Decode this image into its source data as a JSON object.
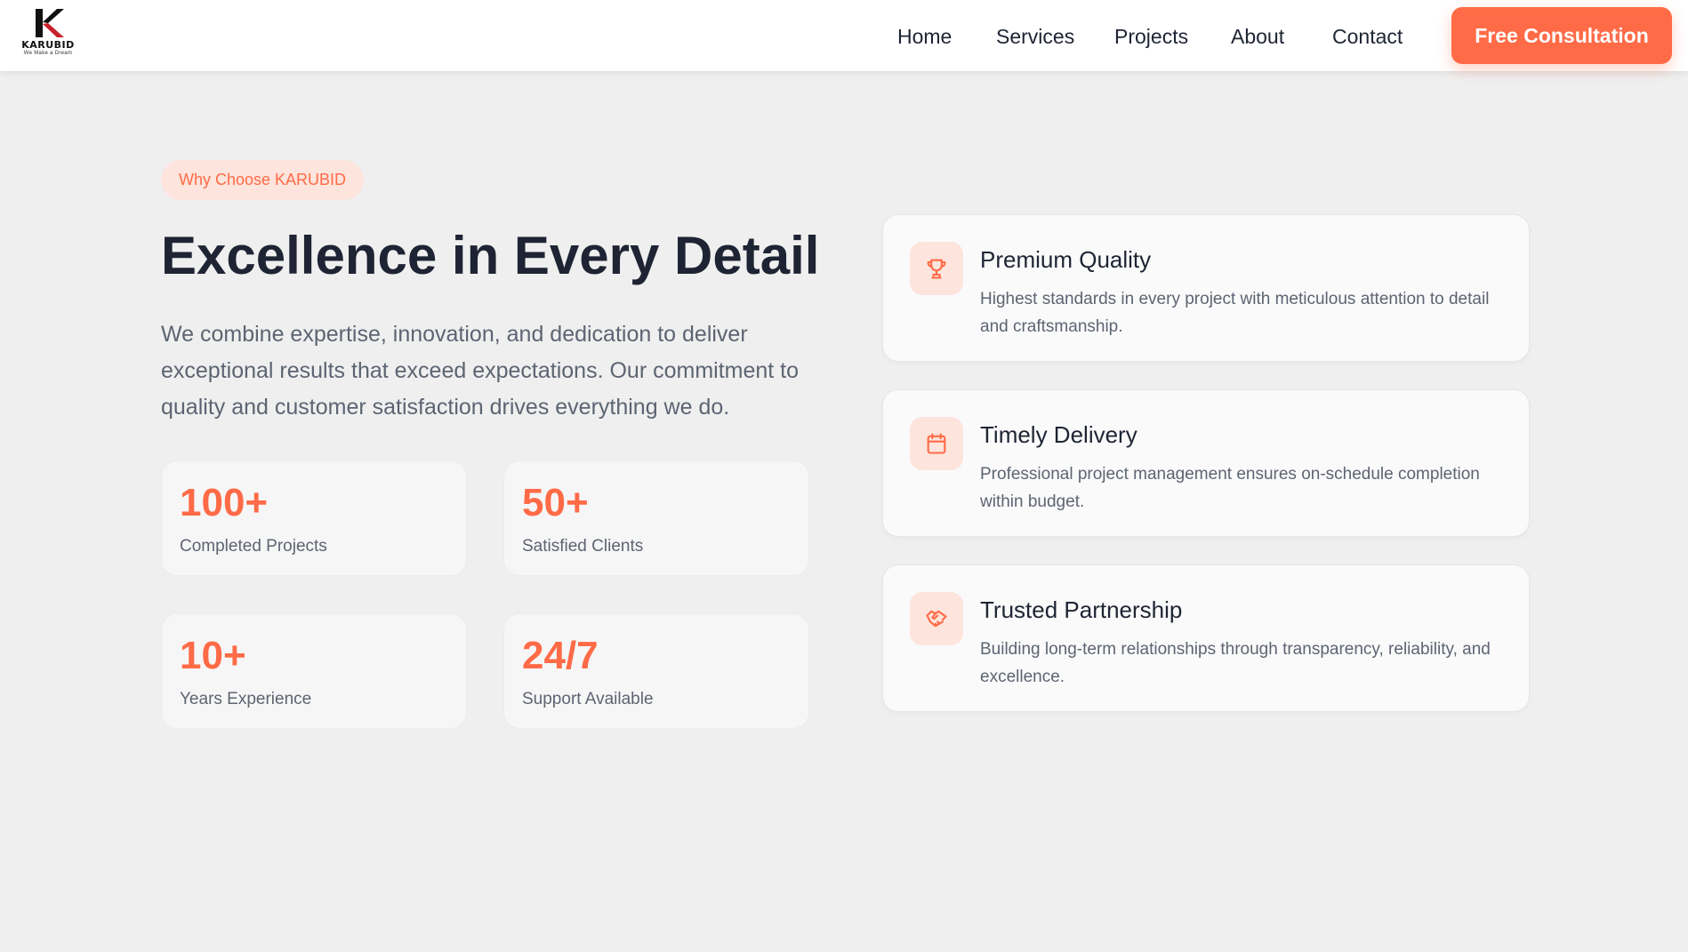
{
  "brand": {
    "name": "KARUBID",
    "tagline": "We Make a Dream",
    "accent_color": "#ff6b47",
    "logo_colors": [
      "#111111",
      "#c8202a"
    ]
  },
  "nav": {
    "items": [
      {
        "label": "Home"
      },
      {
        "label": "Services"
      },
      {
        "label": "Projects"
      },
      {
        "label": "About"
      },
      {
        "label": "Contact"
      }
    ],
    "cta_label": "Free Consultation"
  },
  "hero": {
    "badge": "Why Choose KARUBID",
    "title": "Excellence in Every Detail",
    "description": "We combine expertise, innovation, and dedication to deliver exceptional results that exceed expectations. Our commitment to quality and customer satisfaction drives everything we do."
  },
  "stats": [
    {
      "value": "100+",
      "label": "Completed Projects"
    },
    {
      "value": "50+",
      "label": "Satisfied Clients"
    },
    {
      "value": "10+",
      "label": "Years Experience"
    },
    {
      "value": "24/7",
      "label": "Support Available"
    }
  ],
  "features": [
    {
      "icon": "trophy-icon",
      "title": "Premium Quality",
      "description": "Highest standards in every project with meticulous attention to detail and craftsmanship."
    },
    {
      "icon": "calendar-icon",
      "title": "Timely Delivery",
      "description": "Professional project management ensures on-schedule completion within budget."
    },
    {
      "icon": "handshake-icon",
      "title": "Trusted Partnership",
      "description": "Building long-term relationships through transparency, reliability, and excellence."
    }
  ]
}
